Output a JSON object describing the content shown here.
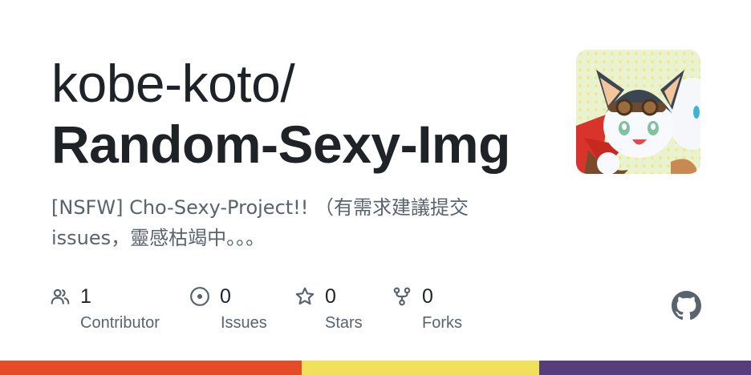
{
  "repo": {
    "owner": "kobe-koto/",
    "name": "Random-Sexy-Img",
    "description_line1": "[NSFW] Cho-Sexy-Project!! （有需求建議提交",
    "description_line2": "issues，靈感枯竭中。。。"
  },
  "stats": [
    {
      "icon": "people-icon",
      "count": "1",
      "label": "Contributor"
    },
    {
      "icon": "issue-icon",
      "count": "0",
      "label": "Issues"
    },
    {
      "icon": "star-icon",
      "count": "0",
      "label": "Stars"
    },
    {
      "icon": "fork-icon",
      "count": "0",
      "label": "Forks"
    }
  ],
  "brand": {
    "icon": "github-icon"
  },
  "colors": {
    "bar_left": "#e34c26",
    "bar_middle": "#f1e05a",
    "bar_right": "#563d7c",
    "text_primary": "#1f2328",
    "text_secondary": "#59636e"
  }
}
